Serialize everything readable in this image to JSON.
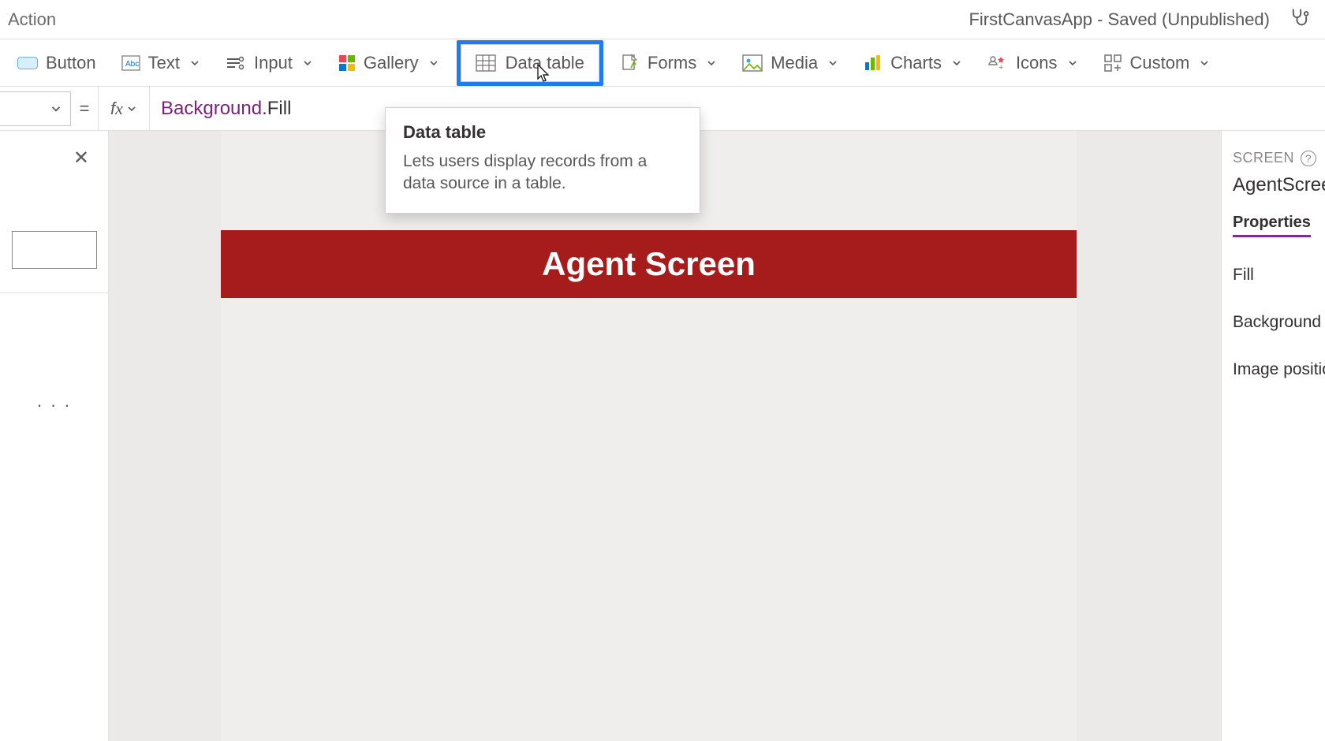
{
  "titlebar": {
    "left_tab": "Action",
    "app_status": "FirstCanvasApp - Saved (Unpublished)"
  },
  "ribbon": {
    "button": "Button",
    "text": "Text",
    "input": "Input",
    "gallery": "Gallery",
    "datatable": "Data table",
    "forms": "Forms",
    "media": "Media",
    "charts": "Charts",
    "icons": "Icons",
    "custom": "Custom"
  },
  "formula": {
    "identifier": "Background",
    "property": ".Fill"
  },
  "tooltip": {
    "title": "Data table",
    "body": "Lets users display records from a data source in a table."
  },
  "canvas": {
    "header": "Agent Screen"
  },
  "left": {
    "more": "· · ·"
  },
  "right": {
    "section": "SCREEN",
    "name": "AgentScree",
    "tab": "Properties",
    "rows": {
      "fill": "Fill",
      "bgimage": "Background i",
      "imgpos": "Image positio"
    }
  }
}
